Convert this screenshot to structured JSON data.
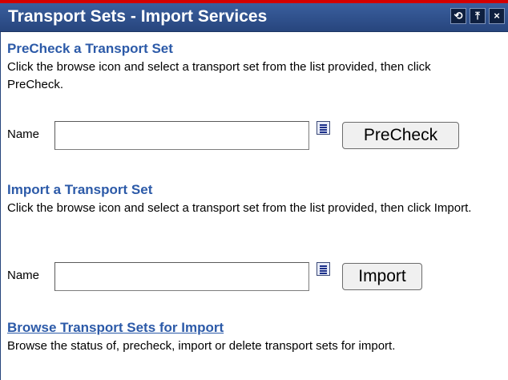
{
  "window": {
    "title": "Transport Sets - Import Services",
    "controls": [
      "refresh-icon",
      "pin-icon",
      "close-icon"
    ],
    "colors": {
      "titlebar": "#2f5190",
      "accent": "#d40000",
      "heading": "#2c5aa8"
    }
  },
  "precheck": {
    "heading": "PreCheck a Transport Set",
    "description": "Click the browse icon and select a transport set from the list provided, then click PreCheck.",
    "name_label": "Name",
    "name_value": "",
    "button_label": "PreCheck"
  },
  "import": {
    "heading": "Import a Transport Set",
    "description": "Click the browse icon and select a transport set from the list provided, then click Import.",
    "name_label": "Name",
    "name_value": "",
    "button_label": "Import"
  },
  "browse": {
    "heading": "Browse Transport Sets for Import",
    "description": "Browse the status of, precheck, import or delete transport sets for import."
  }
}
